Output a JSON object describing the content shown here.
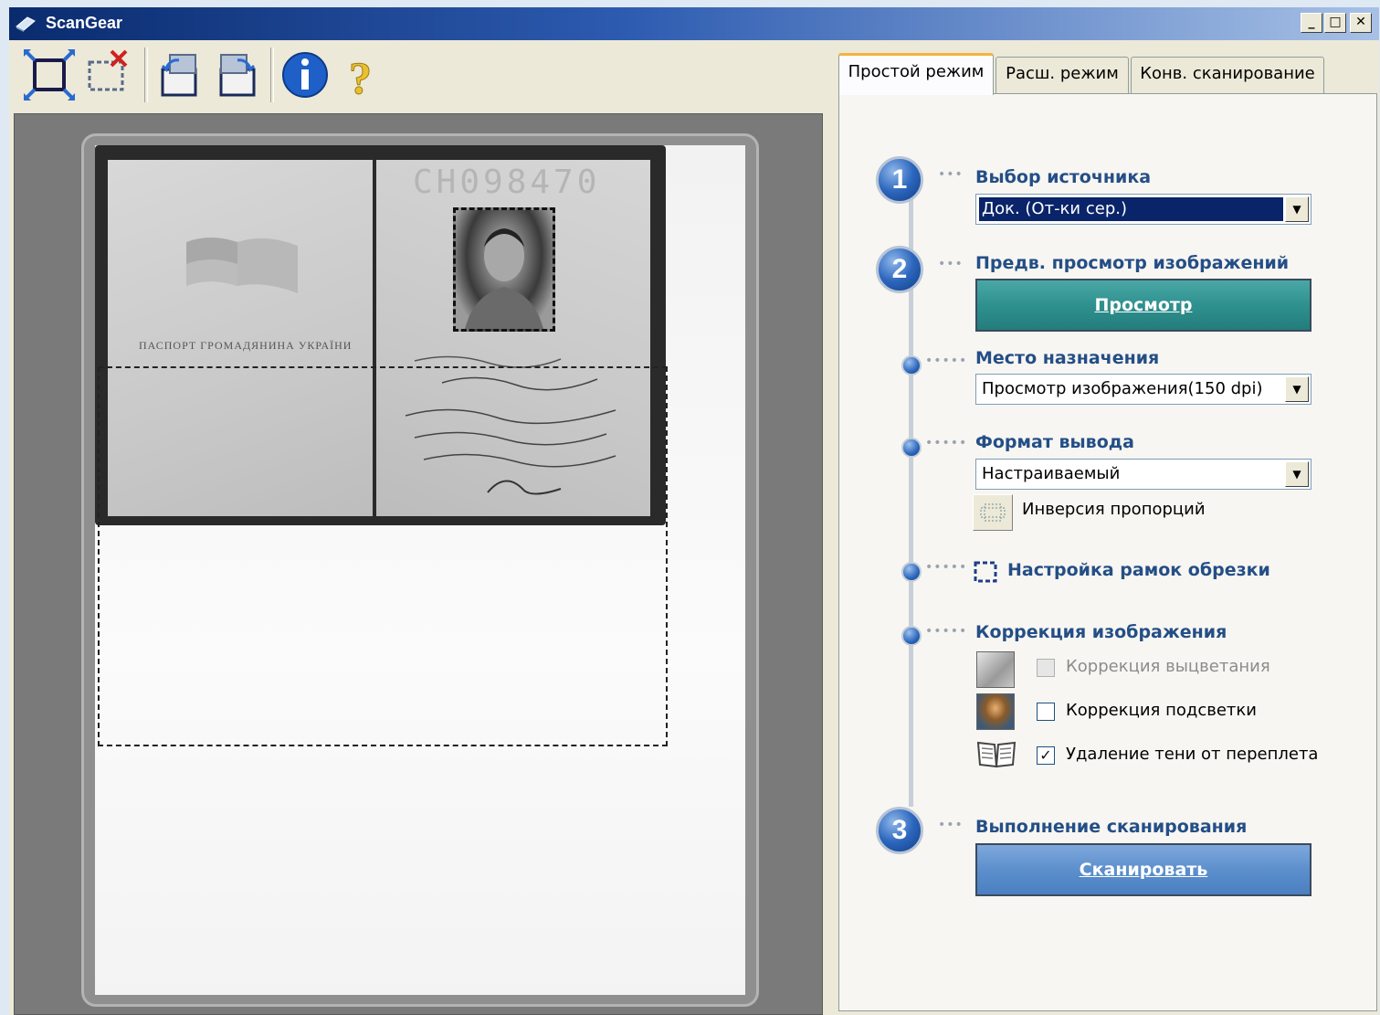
{
  "window": {
    "title": "ScanGear",
    "controls": {
      "minimize": "_",
      "maximize": "□",
      "close": "✕"
    }
  },
  "toolbar": {
    "icons": [
      "auto-crop-icon",
      "remove-crop-icon",
      "rotate-left-icon",
      "rotate-right-icon",
      "info-icon",
      "help-icon"
    ]
  },
  "tabs": [
    {
      "label": "Простой режим",
      "active": true
    },
    {
      "label": "Расш. режим",
      "active": false
    },
    {
      "label": "Конв. сканирование",
      "active": false
    }
  ],
  "steps": {
    "s1": {
      "number": "1",
      "label": "Выбор источника",
      "select_value": "Док. (От-ки сер.)"
    },
    "s2": {
      "number": "2",
      "label": "Предв. просмотр изображений",
      "button": "Просмотр"
    },
    "destination": {
      "label": "Место назначения",
      "select_value": "Просмотр изображения(150 dpi)"
    },
    "output": {
      "label": "Формат вывода",
      "select_value": "Настраиваемый",
      "swap_label": "Инверсия пропорций"
    },
    "crop": {
      "label": "Настройка рамок обрезки"
    },
    "correction": {
      "label": "Коррекция изображения",
      "options": [
        {
          "label": "Коррекция выцветания",
          "checked": false,
          "disabled": true
        },
        {
          "label": "Коррекция подсветки",
          "checked": false,
          "disabled": false
        },
        {
          "label": "Удаление тени от переплета",
          "checked": true,
          "disabled": false
        }
      ]
    },
    "s3": {
      "number": "3",
      "label": "Выполнение сканирования",
      "button": "Сканировать"
    }
  },
  "preview": {
    "document_title": "ПАСПОРТ ГРОМАДЯНИНА УКРАЇНИ",
    "serial": "СН098470"
  },
  "colors": {
    "accent": "#244e86",
    "preview_button": "#2f918f",
    "scan_button": "#5c8fcc",
    "active_tab": "#f1b43e"
  }
}
